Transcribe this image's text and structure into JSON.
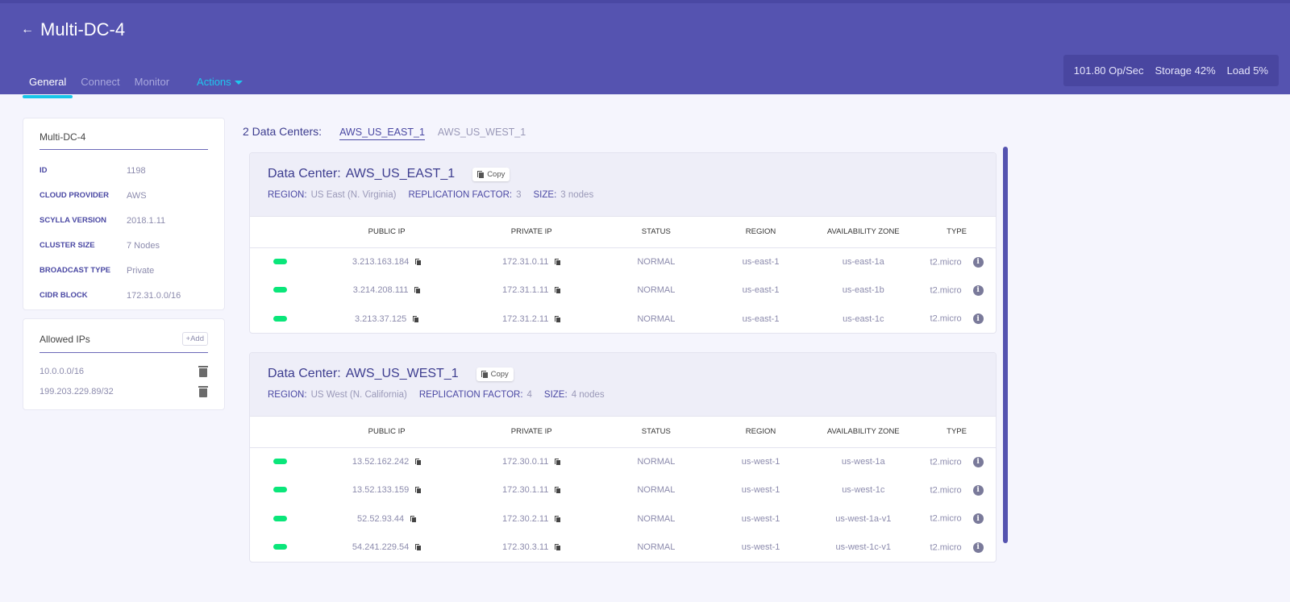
{
  "header": {
    "title": "Multi-DC-4",
    "back_icon": "arrow-left-icon",
    "tabs": [
      {
        "label": "General",
        "active": true
      },
      {
        "label": "Connect",
        "active": false
      },
      {
        "label": "Monitor",
        "active": false
      },
      {
        "label": "Actions",
        "dropdown": true
      }
    ],
    "stats": {
      "ops": "101.80 Op/Sec",
      "storage": "Storage 42%",
      "load": "Load 5%"
    }
  },
  "cluster_info": {
    "title": "Multi-DC-4",
    "rows": [
      {
        "label": "ID",
        "value": "1198"
      },
      {
        "label": "CLOUD PROVIDER",
        "value": "AWS"
      },
      {
        "label": "SCYLLA VERSION",
        "value": "2018.1.11"
      },
      {
        "label": "CLUSTER SIZE",
        "value": "7 Nodes"
      },
      {
        "label": "BROADCAST TYPE",
        "value": "Private"
      },
      {
        "label": "CIDR BLOCK",
        "value": "172.31.0.0/16"
      }
    ]
  },
  "allowed_ips": {
    "title": "Allowed IPs",
    "add_label": "+Add",
    "items": [
      "10.0.0.0/16",
      "199.203.229.89/32"
    ]
  },
  "dc_nav": {
    "count_label": "2 Data Centers:",
    "tabs": [
      {
        "label": "AWS_US_EAST_1",
        "active": true
      },
      {
        "label": "AWS_US_WEST_1",
        "active": false
      }
    ]
  },
  "table_headers": [
    "",
    "PUBLIC IP",
    "PRIVATE IP",
    "STATUS",
    "REGION",
    "AVAILABILITY ZONE",
    "TYPE"
  ],
  "data_centers": [
    {
      "title_label": "Data Center:",
      "name": "AWS_US_EAST_1",
      "copy_label": "Copy",
      "region_label": "REGION:",
      "region": "US East (N. Virginia)",
      "rf_label": "REPLICATION FACTOR:",
      "rf": "3",
      "size_label": "SIZE:",
      "size": "3 nodes",
      "status_color": "#0ae67a",
      "nodes": [
        {
          "public_ip": "3.213.163.184",
          "private_ip": "172.31.0.11",
          "status": "NORMAL",
          "region": "us-east-1",
          "az": "us-east-1a",
          "type": "t2.micro"
        },
        {
          "public_ip": "3.214.208.111",
          "private_ip": "172.31.1.11",
          "status": "NORMAL",
          "region": "us-east-1",
          "az": "us-east-1b",
          "type": "t2.micro"
        },
        {
          "public_ip": "3.213.37.125",
          "private_ip": "172.31.2.11",
          "status": "NORMAL",
          "region": "us-east-1",
          "az": "us-east-1c",
          "type": "t2.micro"
        }
      ]
    },
    {
      "title_label": "Data Center:",
      "name": "AWS_US_WEST_1",
      "copy_label": "Copy",
      "region_label": "REGION:",
      "region": "US West (N. California)",
      "rf_label": "REPLICATION FACTOR:",
      "rf": "4",
      "size_label": "SIZE:",
      "size": "4 nodes",
      "status_color": "#0ae67a",
      "nodes": [
        {
          "public_ip": "13.52.162.242",
          "private_ip": "172.30.0.11",
          "status": "NORMAL",
          "region": "us-west-1",
          "az": "us-west-1a",
          "type": "t2.micro"
        },
        {
          "public_ip": "13.52.133.159",
          "private_ip": "172.30.1.11",
          "status": "NORMAL",
          "region": "us-west-1",
          "az": "us-west-1c",
          "type": "t2.micro"
        },
        {
          "public_ip": "52.52.93.44",
          "private_ip": "172.30.2.11",
          "status": "NORMAL",
          "region": "us-west-1",
          "az": "us-west-1a-v1",
          "type": "t2.micro"
        },
        {
          "public_ip": "54.241.229.54",
          "private_ip": "172.30.3.11",
          "status": "NORMAL",
          "region": "us-west-1",
          "az": "us-west-1c-v1",
          "type": "t2.micro"
        }
      ]
    }
  ],
  "colors": {
    "header_bg": "#5553b0",
    "accent": "#1ec8ef",
    "status_ok": "#0ae67a"
  }
}
